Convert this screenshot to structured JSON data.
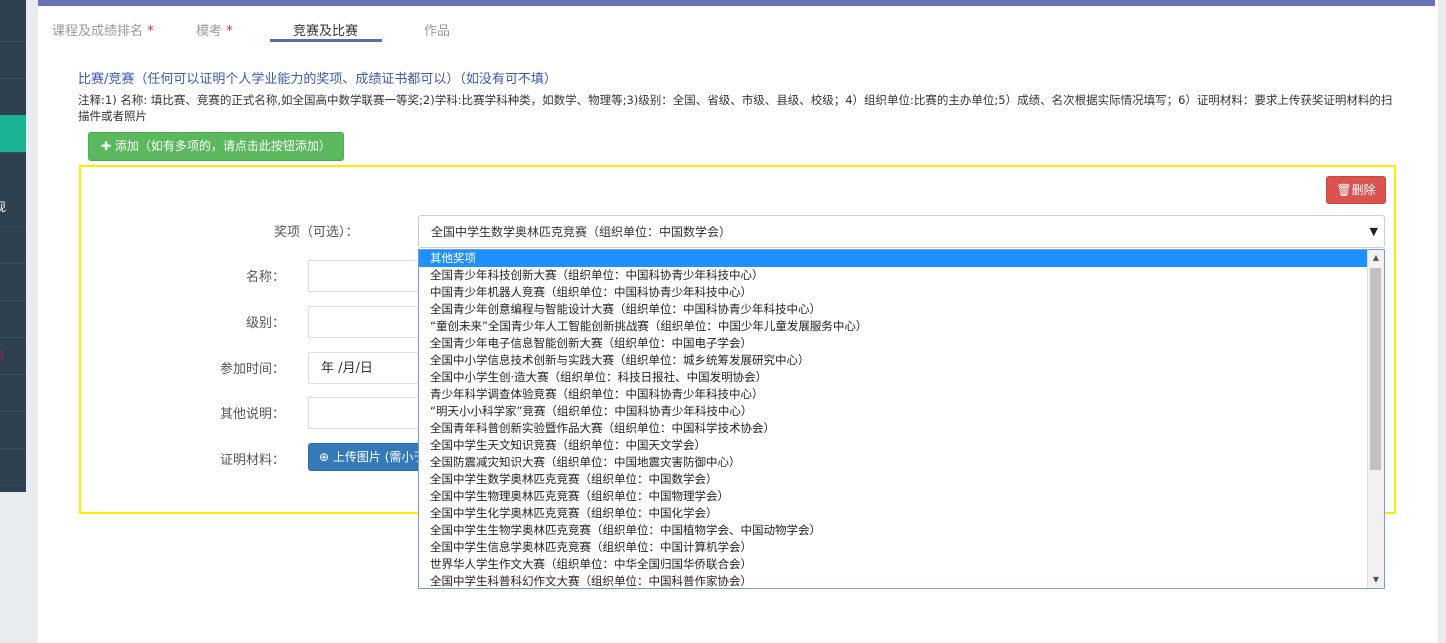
{
  "sidebar": {
    "items": [
      {
        "label": ""
      },
      {
        "label": ""
      },
      {
        "label": ""
      },
      {
        "label": ""
      },
      {
        "label": "现"
      },
      {
        "label": ""
      },
      {
        "label": ""
      },
      {
        "label": ""
      },
      {
        "label": "☆"
      },
      {
        "label": ""
      },
      {
        "label": ""
      },
      {
        "label": ""
      }
    ],
    "active_index": 3
  },
  "tabs": [
    {
      "label": "课程及成绩排名",
      "required": "*"
    },
    {
      "label": "模考",
      "required": "*"
    },
    {
      "label": "竞赛及比赛",
      "required": ""
    },
    {
      "label": "作品",
      "required": ""
    }
  ],
  "section": {
    "title": "比赛/竞赛（任何可以证明个人学业能力的奖项、成绩证书都可以）（如没有可不填）",
    "note": "注释:1) 名称: 填比赛、竞赛的正式名称,如全国高中数学联赛一等奖;2)学科:比赛学科种类，如数学、物理等;3)级别：全国、省级、市级、县级、校级；4）组织单位:比赛的主办单位;5）成绩、名次根据实际情况填写；6）证明材料：要求上传获奖证明材料的扫描件或者照片",
    "add_button": "添加（如有多项的，请点击此按钮添加）"
  },
  "form": {
    "delete_button": "删除",
    "award_label": "奖项（可选）：",
    "award_selected": "全国中学生数学奥林匹克竞赛（组织单位：中国数学会）",
    "name_label": "名称：",
    "level_label": "级别：",
    "date_label": "参加时间：",
    "date_placeholder": "年 /月/日",
    "other_label": "其他说明：",
    "proof_label": "证明材料：",
    "upload_button": "上传图片 (需小于"
  },
  "dropdown_options": [
    "其他奖项",
    "全国青少年科技创新大赛（组织单位：中国科协青少年科技中心）",
    "中国青少年机器人竞赛（组织单位：中国科协青少年科技中心）",
    "全国青少年创意编程与智能设计大赛（组织单位：中国科协青少年科技中心）",
    "“童创未来”全国青少年人工智能创新挑战赛（组织单位：中国少年儿童发展服务中心）",
    "全国青少年电子信息智能创新大赛（组织单位：中国电子学会）",
    "全国中小学信息技术创新与实践大赛（组织单位：城乡统筹发展研究中心）",
    "全国中小学生创·造大赛（组织单位：科技日报社、中国发明协会）",
    "青少年科学调查体验竞赛（组织单位：中国科协青少年科技中心）",
    "“明天小小科学家”竞赛（组织单位：中国科协青少年科技中心）",
    "全国青年科普创新实验暨作品大赛（组织单位：中国科学技术协会）",
    "全国中学生天文知识竞赛（组织单位：中国天文学会）",
    "全国防震减灾知识大赛（组织单位：中国地震灾害防御中心）",
    "全国中学生数学奥林匹克竞赛（组织单位：中国数学会）",
    "全国中学生物理奥林匹克竞赛（组织单位：中国物理学会）",
    "全国中学生化学奥林匹克竞赛（组织单位：中国化学会）",
    "全国中学生生物学奥林匹克竞赛（组织单位：中国植物学会、中国动物学会）",
    "全国中学生信息学奥林匹克竞赛（组织单位：中国计算机学会）",
    "世界华人学生作文大赛（组织单位：中华全国归国华侨联合会）",
    "全国中学生科普科幻作文大赛（组织单位：中国科普作家协会）"
  ],
  "colors": {
    "accent": "#6b73b8",
    "add_green": "#5cb85c",
    "delete_red": "#d9534f",
    "upload_blue": "#337ab7",
    "card_border": "#ffee00",
    "option_highlight": "#1e90ff"
  },
  "icons": {
    "add": "plus-icon",
    "delete": "trash-icon",
    "upload": "upload-circle-icon",
    "select_arrow": "triangle-down-icon"
  }
}
